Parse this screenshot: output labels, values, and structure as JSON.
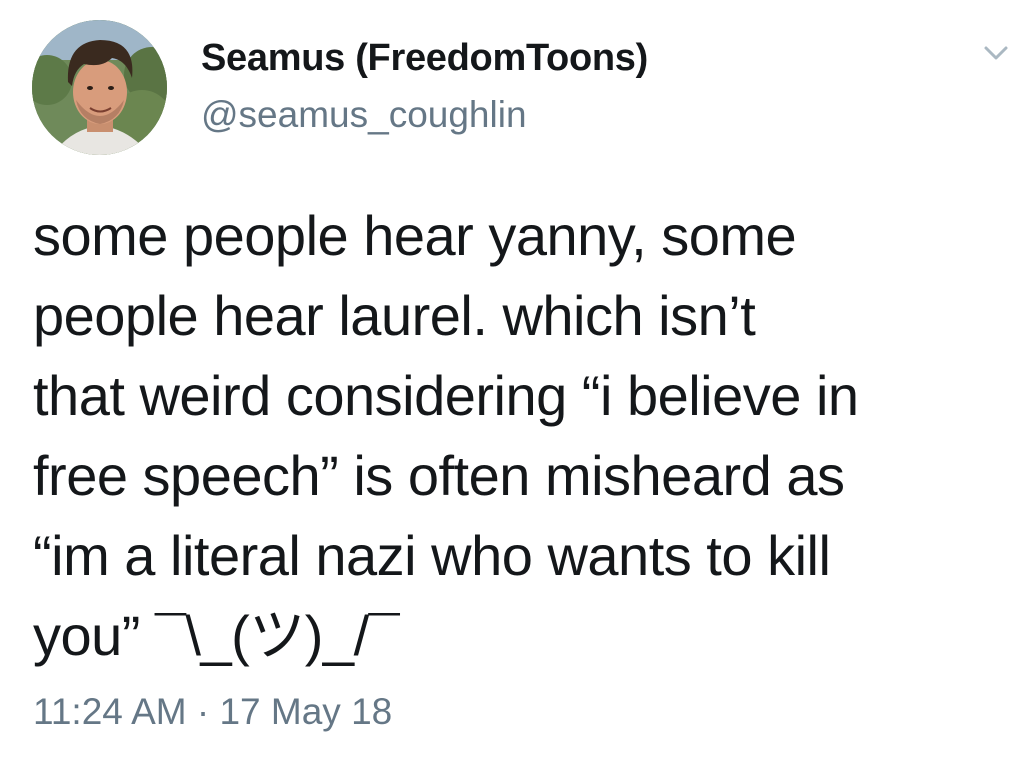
{
  "tweet": {
    "display_name": "Seamus (FreedomToons)",
    "handle": "@seamus_coughlin",
    "text": "some people hear yanny, some\npeople hear laurel.  which isn’t\nthat weird considering “i believe in\nfree speech” is often misheard as\n“im a literal nazi who wants to kill\nyou” ¯\\_(ツ)_/¯",
    "timestamp": "11:24 AM · 17 May 18"
  },
  "icons": {
    "avatar": "user-avatar-photo",
    "menu": "chevron-down-icon"
  },
  "colors": {
    "primary_text": "#14171a",
    "secondary_text": "#657786",
    "caret": "#aab8c2",
    "background": "#ffffff"
  }
}
